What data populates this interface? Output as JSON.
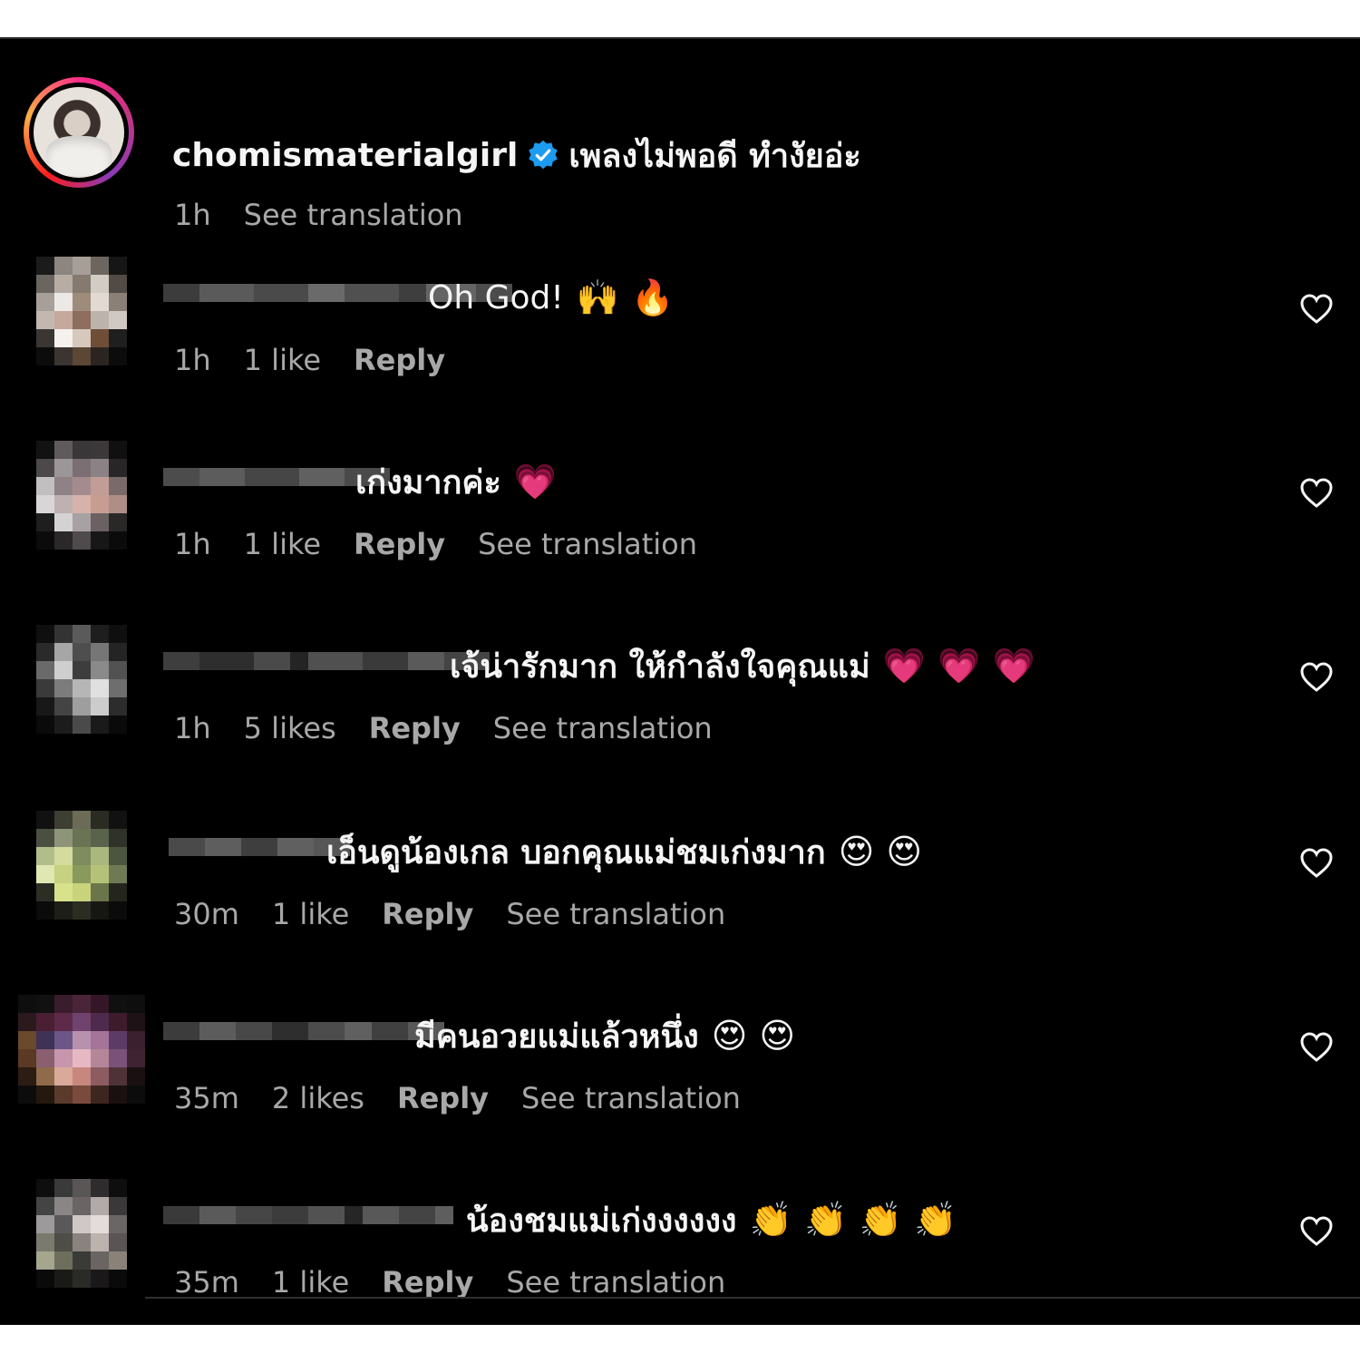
{
  "post": {
    "username": "chomismaterialgirl",
    "text": "เพลงไม่พอดี ทำงัยอ่ะ",
    "time": "1h",
    "see_translation": "See translation"
  },
  "comments": [
    {
      "text": "Oh God!",
      "emoji": "🙌 🔥",
      "time": "1h",
      "likes": "1 like",
      "reply": "Reply",
      "see_translation": ""
    },
    {
      "text": "เก่งมากค่ะ",
      "emoji": "💗",
      "time": "1h",
      "likes": "1 like",
      "reply": "Reply",
      "see_translation": "See translation"
    },
    {
      "text": "เจ้น่ารักมาก ให้กำลังใจคุณแม่",
      "emoji": "💗 💗 💗",
      "time": "1h",
      "likes": "5 likes",
      "reply": "Reply",
      "see_translation": "See translation"
    },
    {
      "text": "เอ็นดูน้องเกล บอกคุณแม่ชมเก่งมาก",
      "emoji": "😍 😍",
      "time": "30m",
      "likes": "1 like",
      "reply": "Reply",
      "see_translation": "See translation"
    },
    {
      "text": "มีคนอวยแม่แล้วหนึ่ง",
      "emoji": "😍 😍",
      "time": "35m",
      "likes": "2 likes",
      "reply": "Reply",
      "see_translation": "See translation"
    },
    {
      "text": "น้องชมแม่เก่งงงงงง",
      "emoji": "👏 👏 👏 👏",
      "time": "35m",
      "likes": "1 like",
      "reply": "Reply",
      "see_translation": "See translation"
    }
  ],
  "icons": {
    "verified": "verified-badge-icon",
    "like": "heart-outline-icon"
  },
  "colors": {
    "background": "#000000",
    "text": "#f5f5f5",
    "meta": "#a8a8a8",
    "verified": "#1d9bf0"
  }
}
